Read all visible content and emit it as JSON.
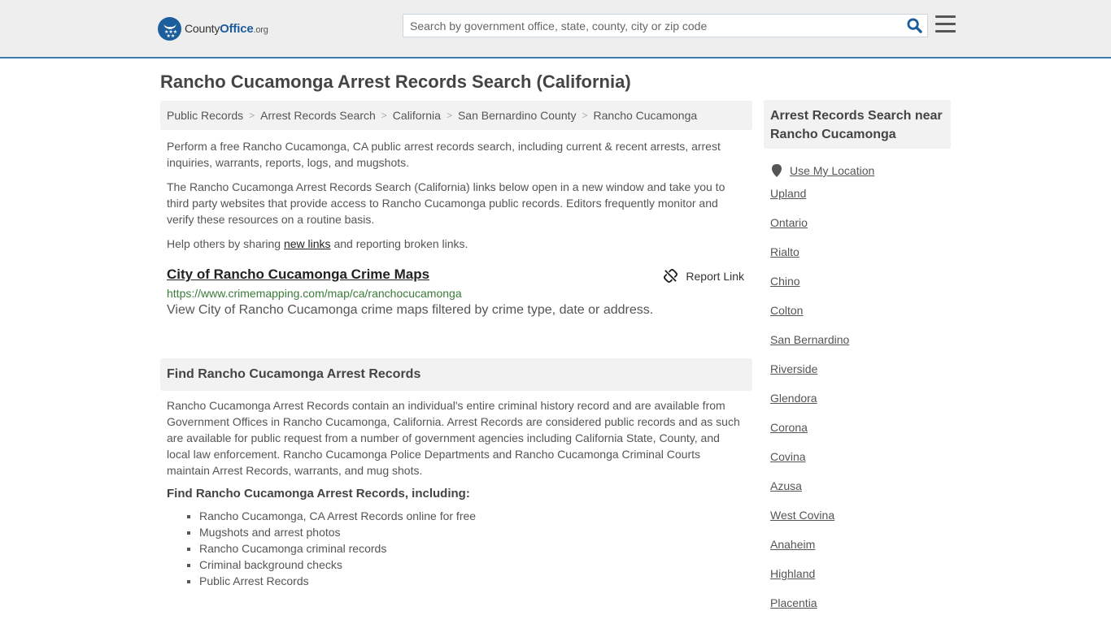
{
  "header": {
    "logo": {
      "name": "County",
      "name_accent": "Office",
      "tld": ".org"
    },
    "search_placeholder": "Search by government office, state, county, city or zip code",
    "search_value": "",
    "search_icon": "search-icon",
    "menu_icon": "hamburger-menu-icon",
    "brand_color": "#1c5d9c",
    "accent_border_color": "#3a7cab"
  },
  "page": {
    "title": "Rancho Cucamonga Arrest Records Search (California)"
  },
  "breadcrumb": [
    {
      "label": "Public Records"
    },
    {
      "label": "Arrest Records Search"
    },
    {
      "label": "California"
    },
    {
      "label": "San Bernardino County"
    },
    {
      "label": "Rancho Cucamonga"
    }
  ],
  "intro": {
    "p1": "Perform a free Rancho Cucamonga, CA public arrest records search, including current & recent arrests, arrest inquiries, warrants, reports, logs, and mugshots.",
    "p2": "The Rancho Cucamonga Arrest Records Search (California) links below open in a new window and take you to third party websites that provide access to Rancho Cucamonga public records. Editors frequently monitor and verify these resources on a routine basis.",
    "p3_before": "Help others by sharing ",
    "p3_link": "new links",
    "p3_after": " and reporting broken links."
  },
  "results": [
    {
      "title": "City of Rancho Cucamonga Crime Maps",
      "url": "https://www.crimemapping.com/map/ca/ranchocucamonga",
      "description": "View City of Rancho Cucamonga crime maps filtered by crime type, date or address.",
      "report_label": "Report Link",
      "url_color": "#3a7a3a"
    }
  ],
  "section": {
    "heading": "Find Rancho Cucamonga Arrest Records",
    "body": "Rancho Cucamonga Arrest Records contain an individual's entire criminal history record and are available from Government Offices in Rancho Cucamonga, California. Arrest Records are considered public records and as such are available for public request from a number of government agencies including California State, County, and local law enforcement. Rancho Cucamonga Police Departments and Rancho Cucamonga Criminal Courts maintain Arrest Records, warrants, and mug shots.",
    "subheading": "Find Rancho Cucamonga Arrest Records, including:",
    "bullets": [
      "Rancho Cucamonga, CA Arrest Records online for free",
      "Mugshots and arrest photos",
      "Rancho Cucamonga criminal records",
      "Criminal background checks",
      "Public Arrest Records"
    ]
  },
  "sidebar": {
    "heading": "Arrest Records Search near Rancho Cucamonga",
    "use_location": "Use My Location",
    "cities": [
      "Upland",
      "Ontario",
      "Rialto",
      "Chino",
      "Colton",
      "San Bernardino",
      "Riverside",
      "Glendora",
      "Corona",
      "Covina",
      "Azusa",
      "West Covina",
      "Anaheim",
      "Highland",
      "Placentia"
    ]
  }
}
